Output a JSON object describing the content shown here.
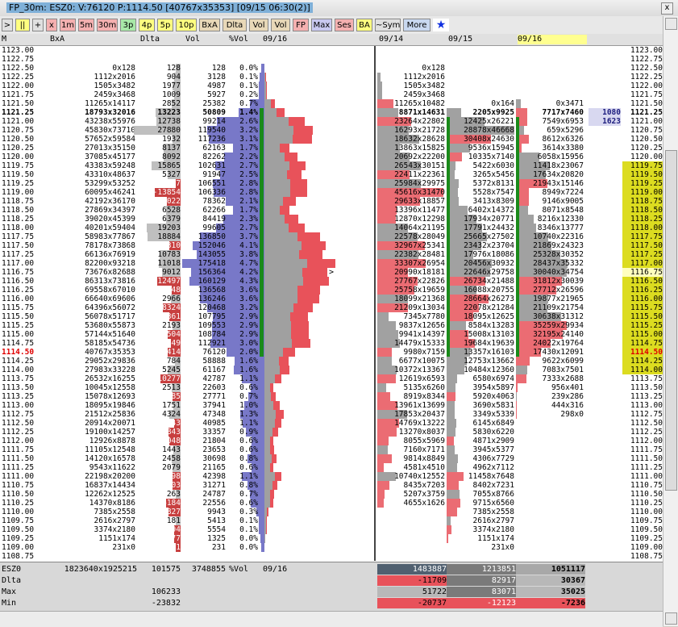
{
  "title": "FP_30m: ESZ0: V:76120 P:1114.50 [40767x35353] [09/15 06:30(2)]",
  "close_label": "x",
  "toolbar": [
    {
      "label": ">",
      "bg": "#e0e0e0",
      "w": 14
    },
    {
      "label": "||",
      "bg": "#ffff80",
      "w": 18
    },
    {
      "label": "+",
      "bg": "#e0e0e0",
      "w": 14
    },
    {
      "label": "x",
      "bg": "#f4b0b0",
      "w": 14
    },
    {
      "label": "1m",
      "bg": "#f4b0b0",
      "w": 20
    },
    {
      "label": "5m",
      "bg": "#f4b0b0",
      "w": 20
    },
    {
      "label": "30m",
      "bg": "#f4b0b0",
      "w": 26
    },
    {
      "label": "3p",
      "bg": "#a8e8a8",
      "w": 20
    },
    {
      "label": "4p",
      "bg": "#ffff80",
      "w": 20
    },
    {
      "label": "5p",
      "bg": "#ffff80",
      "w": 20
    },
    {
      "label": "10p",
      "bg": "#ffff80",
      "w": 26
    },
    {
      "label": "BxA",
      "bg": "#e8d8b8",
      "w": 26
    },
    {
      "label": "Dlta",
      "bg": "#e8d8b8",
      "w": 30
    },
    {
      "label": "Vol",
      "bg": "#e8d8b8",
      "w": 24
    },
    {
      "label": "Vol",
      "bg": "#e8d8b8",
      "w": 24
    },
    {
      "label": "FP",
      "bg": "#f4b0b0",
      "w": 20
    },
    {
      "label": "Max",
      "bg": "#c8c8f0",
      "w": 26
    },
    {
      "label": "Ses",
      "bg": "#f4b0b0",
      "w": 24
    },
    {
      "label": "BA",
      "bg": "#ffff80",
      "w": 20
    },
    {
      "label": "~Sym",
      "bg": "#e0e0e0",
      "w": 32
    },
    {
      "label": "More",
      "bg": "#c8d8f0",
      "w": 34
    },
    {
      "label": "★",
      "bg": "#ffffff",
      "w": 20
    }
  ],
  "header": {
    "m": "M",
    "bxa": "BxA",
    "dlta": "Dlta",
    "vol": "Vol",
    "pvol": "%Vol",
    "d1": "09/16",
    "d2": "09/14",
    "d3": "09/15",
    "d4": "09/16"
  },
  "rows": [
    {
      "p": "1123.00",
      "bxa": "",
      "d": "",
      "v": "",
      "pv": "",
      "c2": "",
      "c3": "",
      "c4": ""
    },
    {
      "p": "1122.75",
      "bxa": "",
      "d": "",
      "v": "",
      "pv": "",
      "c2": "",
      "c3": "",
      "c4": ""
    },
    {
      "p": "1122.50",
      "bxa": "0x128",
      "d": "128",
      "v": "128",
      "pv": "0.0%",
      "c2": "0x128",
      "c3": "",
      "c4": ""
    },
    {
      "p": "1122.25",
      "bxa": "1112x2016",
      "d": "904",
      "v": "3128",
      "pv": "0.1%",
      "c2": "1112x2016",
      "c3": "",
      "c4": ""
    },
    {
      "p": "1122.00",
      "bxa": "1505x3482",
      "d": "1977",
      "v": "4987",
      "pv": "0.1%",
      "c2": "1505x3482",
      "c3": "",
      "c4": ""
    },
    {
      "p": "1121.75",
      "bxa": "2459x3468",
      "d": "1009",
      "v": "5927",
      "pv": "0.2%",
      "c2": "2459x3468",
      "c3": "",
      "c4": ""
    },
    {
      "p": "1121.50",
      "bxa": "11265x14117",
      "d": "2852",
      "v": "25382",
      "pv": "0.7%",
      "c2": "11265x10482",
      "c3": "0x164",
      "c4": "0x3471"
    },
    {
      "p": "1121.25",
      "bxa": "18793x32016",
      "d": "13223",
      "v": "50809",
      "pv": "1.4%",
      "c2": "8871x14631",
      "c3": "2205x9925",
      "c4": "7717x7460",
      "bold": true
    },
    {
      "p": "1121.00",
      "bxa": "43238x55976",
      "d": "12738",
      "v": "99214",
      "pv": "2.6%",
      "c2": "23264x22802",
      "c3": "12425x26221",
      "c4": "7549x6953"
    },
    {
      "p": "1120.75",
      "bxa": "45830x73710",
      "d": "27880",
      "v": "119540",
      "pv": "3.2%",
      "c2": "16293x21728",
      "c3": "28878x46668",
      "c4": "659x5296"
    },
    {
      "p": "1120.50",
      "bxa": "57652x59584",
      "d": "1932",
      "v": "117236",
      "pv": "3.1%",
      "c2": "18632x28628",
      "c3": "30408x24630",
      "c4": "8612x6326"
    },
    {
      "p": "1120.25",
      "bxa": "27013x35150",
      "d": "8137",
      "v": "62163",
      "pv": "1.7%",
      "c2": "13863x15825",
      "c3": "9536x15945",
      "c4": "3614x3380"
    },
    {
      "p": "1120.00",
      "bxa": "37085x45177",
      "d": "8092",
      "v": "82262",
      "pv": "2.2%",
      "c2": "20692x22200",
      "c3": "10335x7140",
      "c4": "6058x15956"
    },
    {
      "p": "1119.75",
      "bxa": "43383x59248",
      "d": "15865",
      "v": "102631",
      "pv": "2.7%",
      "c2": "26543x30151",
      "c3": "5422x6030",
      "c4": "11418x23067"
    },
    {
      "p": "1119.50",
      "bxa": "43310x48637",
      "d": "5327",
      "v": "91947",
      "pv": "2.5%",
      "c2": "22411x22361",
      "c3": "3265x5456",
      "c4": "17634x20820"
    },
    {
      "p": "1119.25",
      "bxa": "53299x53252",
      "d": "-47",
      "v": "106551",
      "pv": "2.8%",
      "c2": "25984x29975",
      "c3": "5372x8131",
      "c4": "21943x15146"
    },
    {
      "p": "1119.00",
      "bxa": "60095x46241",
      "d": "-13854",
      "v": "106336",
      "pv": "2.8%",
      "c2": "45616x31470",
      "c3": "5528x7547",
      "c4": "8949x7224"
    },
    {
      "p": "1118.75",
      "bxa": "42192x36170",
      "d": "-6022",
      "v": "78362",
      "pv": "2.1%",
      "c2": "29633x18857",
      "c3": "3413x8309",
      "c4": "9146x9005"
    },
    {
      "p": "1118.50",
      "bxa": "27869x34397",
      "d": "6528",
      "v": "62266",
      "pv": "1.7%",
      "c2": "13396x11477",
      "c3": "6402x14372",
      "c4": "8071x8548"
    },
    {
      "p": "1118.25",
      "bxa": "39020x45399",
      "d": "6379",
      "v": "84419",
      "pv": "2.3%",
      "c2": "12870x12298",
      "c3": "17934x20771",
      "c4": "8216x12330"
    },
    {
      "p": "1118.00",
      "bxa": "40201x59404",
      "d": "19203",
      "v": "99605",
      "pv": "2.7%",
      "c2": "14064x21195",
      "c3": "17791x24432",
      "c4": "8346x13777"
    },
    {
      "p": "1117.75",
      "bxa": "58983x77867",
      "d": "18884",
      "v": "136850",
      "pv": "3.7%",
      "c2": "22578x28049",
      "c3": "25665x27502",
      "c4": "10740x22316"
    },
    {
      "p": "1117.50",
      "bxa": "78178x73868",
      "d": "-4310",
      "v": "152046",
      "pv": "4.1%",
      "c2": "32967x25341",
      "c3": "23432x23704",
      "c4": "21869x24323"
    },
    {
      "p": "1117.25",
      "bxa": "66136x76919",
      "d": "10783",
      "v": "143055",
      "pv": "3.8%",
      "c2": "22382x28481",
      "c3": "17976x18086",
      "c4": "25328x30352"
    },
    {
      "p": "1117.00",
      "bxa": "82200x93218",
      "d": "11018",
      "v": "175418",
      "pv": "4.7%",
      "c2": "33307x26954",
      "c3": "20456x30932",
      "c4": "28437x35332"
    },
    {
      "p": "1116.75",
      "bxa": "73676x82688",
      "d": "9012",
      "v": "156364",
      "pv": "4.2%",
      "c2": "20990x18181",
      "c3": "22646x29758",
      "c4": "30040x34754"
    },
    {
      "p": "1116.50",
      "bxa": "86313x73816",
      "d": "-12497",
      "v": "160129",
      "pv": "4.3%",
      "c2": "27767x22826",
      "c3": "26734x21488",
      "c4": "31812x30039"
    },
    {
      "p": "1116.25",
      "bxa": "69558x67010",
      "d": "-2548",
      "v": "136568",
      "pv": "3.6%",
      "c2": "25758x19659",
      "c3": "16088x20755",
      "c4": "27712x26596"
    },
    {
      "p": "1116.00",
      "bxa": "66640x69606",
      "d": "2966",
      "v": "136246",
      "pv": "3.6%",
      "c2": "18099x21368",
      "c3": "28664x26273",
      "c4": "19877x21965"
    },
    {
      "p": "1115.75",
      "bxa": "64396x56072",
      "d": "-8324",
      "v": "120468",
      "pv": "3.2%",
      "c2": "21209x13034",
      "c3": "22078x21284",
      "c4": "21109x21754"
    },
    {
      "p": "1115.50",
      "bxa": "56078x51717",
      "d": "-4361",
      "v": "107795",
      "pv": "2.9%",
      "c2": "7345x7780",
      "c3": "18095x12625",
      "c4": "30638x31312"
    },
    {
      "p": "1115.25",
      "bxa": "53680x55873",
      "d": "2193",
      "v": "109553",
      "pv": "2.9%",
      "c2": "9837x12656",
      "c3": "8584x13283",
      "c4": "35259x29934"
    },
    {
      "p": "1115.00",
      "bxa": "57144x51640",
      "d": "-5504",
      "v": "108784",
      "pv": "2.9%",
      "c2": "9941x14397",
      "c3": "15008x13103",
      "c4": "32195x24140"
    },
    {
      "p": "1114.75",
      "bxa": "58185x54736",
      "d": "-3449",
      "v": "112921",
      "pv": "3.0%",
      "c2": "14479x15333",
      "c3": "19684x19639",
      "c4": "24022x19764"
    },
    {
      "p": "1114.50",
      "bxa": "40767x35353",
      "d": "-5414",
      "v": "76120",
      "pv": "2.0%",
      "c2": "9980x7159",
      "c3": "13357x16103",
      "c4": "17430x12091",
      "cur": true
    },
    {
      "p": "1114.25",
      "bxa": "29052x29836",
      "d": "784",
      "v": "58888",
      "pv": "1.6%",
      "c2": "6677x10075",
      "c3": "12753x13662",
      "c4": "9622x6099"
    },
    {
      "p": "1114.00",
      "bxa": "27983x33228",
      "d": "5245",
      "v": "61167",
      "pv": "1.6%",
      "c2": "10372x13367",
      "c3": "10484x12360",
      "c4": "7083x7501"
    },
    {
      "p": "1113.75",
      "bxa": "26532x16255",
      "d": "-10277",
      "v": "42787",
      "pv": "1.1%",
      "c2": "12619x6593",
      "c3": "6580x6974",
      "c4": "7333x2688"
    },
    {
      "p": "1113.50",
      "bxa": "10045x12558",
      "d": "2513",
      "v": "22603",
      "pv": "0.6%",
      "c2": "5135x6260",
      "c3": "3954x5897",
      "c4": "956x401"
    },
    {
      "p": "1113.25",
      "bxa": "15078x12693",
      "d": "-2385",
      "v": "27771",
      "pv": "0.7%",
      "c2": "8919x8344",
      "c3": "5920x4063",
      "c4": "239x286"
    },
    {
      "p": "1113.00",
      "bxa": "18095x19846",
      "d": "1751",
      "v": "37941",
      "pv": "1.0%",
      "c2": "13961x13699",
      "c3": "3690x5831",
      "c4": "444x316"
    },
    {
      "p": "1112.75",
      "bxa": "21512x25836",
      "d": "4324",
      "v": "47348",
      "pv": "1.3%",
      "c2": "17853x20437",
      "c3": "3349x5339",
      "c4": "298x0"
    },
    {
      "p": "1112.50",
      "bxa": "20914x20071",
      "d": "-843",
      "v": "40985",
      "pv": "1.1%",
      "c2": "14769x13222",
      "c3": "6145x6849",
      "c4": ""
    },
    {
      "p": "1112.25",
      "bxa": "19100x14257",
      "d": "-4843",
      "v": "33357",
      "pv": "0.9%",
      "c2": "13270x8037",
      "c3": "5830x6220",
      "c4": ""
    },
    {
      "p": "1112.00",
      "bxa": "12926x8878",
      "d": "-4048",
      "v": "21804",
      "pv": "0.6%",
      "c2": "8055x5969",
      "c3": "4871x2909",
      "c4": ""
    },
    {
      "p": "1111.75",
      "bxa": "11105x12548",
      "d": "1443",
      "v": "23653",
      "pv": "0.6%",
      "c2": "7160x7171",
      "c3": "3945x5377",
      "c4": ""
    },
    {
      "p": "1111.50",
      "bxa": "14120x16578",
      "d": "2458",
      "v": "30698",
      "pv": "0.8%",
      "c2": "9814x8849",
      "c3": "4306x7729",
      "c4": ""
    },
    {
      "p": "1111.25",
      "bxa": "9543x11622",
      "d": "2079",
      "v": "21165",
      "pv": "0.6%",
      "c2": "4581x4510",
      "c3": "4962x7112",
      "c4": ""
    },
    {
      "p": "1111.00",
      "bxa": "22198x20200",
      "d": "-1998",
      "v": "42398",
      "pv": "1.1%",
      "c2": "10740x12552",
      "c3": "11458x7648",
      "c4": ""
    },
    {
      "p": "1110.75",
      "bxa": "16837x14434",
      "d": "-2403",
      "v": "31271",
      "pv": "0.8%",
      "c2": "8435x7203",
      "c3": "8402x7231",
      "c4": ""
    },
    {
      "p": "1110.50",
      "bxa": "12262x12525",
      "d": "263",
      "v": "24787",
      "pv": "0.7%",
      "c2": "5207x3759",
      "c3": "7055x8766",
      "c4": ""
    },
    {
      "p": "1110.25",
      "bxa": "14370x8186",
      "d": "-6184",
      "v": "22556",
      "pv": "0.6%",
      "c2": "4655x1626",
      "c3": "9715x6560",
      "c4": ""
    },
    {
      "p": "1110.00",
      "bxa": "7385x2558",
      "d": "-4827",
      "v": "9943",
      "pv": "0.3%",
      "c2": "",
      "c3": "7385x2558",
      "c4": ""
    },
    {
      "p": "1109.75",
      "bxa": "2616x2797",
      "d": "181",
      "v": "5413",
      "pv": "0.1%",
      "c2": "",
      "c3": "2616x2797",
      "c4": ""
    },
    {
      "p": "1109.50",
      "bxa": "3374x2180",
      "d": "-1194",
      "v": "5554",
      "pv": "0.1%",
      "c2": "",
      "c3": "3374x2180",
      "c4": ""
    },
    {
      "p": "1109.25",
      "bxa": "1151x174",
      "d": "-977",
      "v": "1325",
      "pv": "0.0%",
      "c2": "",
      "c3": "1151x174",
      "c4": ""
    },
    {
      "p": "1109.00",
      "bxa": "231x0",
      "d": "-231",
      "v": "231",
      "pv": "0.0%",
      "c2": "",
      "c3": "231x0",
      "c4": ""
    },
    {
      "p": "1108.75",
      "bxa": "",
      "d": "",
      "v": "",
      "pv": "",
      "c2": "",
      "c3": "",
      "c4": ""
    }
  ],
  "side_labels": [
    {
      "text": "1080",
      "row": 7
    },
    {
      "text": "1623",
      "row": 8
    }
  ],
  "footer": {
    "rows": [
      {
        "label": "ESZ0",
        "bxa": "1823640x1925215",
        "d": "101575",
        "v": "3748855",
        "pv": "%Vol",
        "d1": "09/16",
        "c2": "1483887",
        "c3": "1213851",
        "c4": "1051117"
      },
      {
        "label": "Dlta",
        "bxa": "",
        "d": "",
        "v": "",
        "pv": "",
        "d1": "",
        "c2": "-11709",
        "c3": "82917",
        "c4": "30367"
      },
      {
        "label": "Max",
        "bxa": "",
        "d": "106233",
        "v": "",
        "pv": "",
        "d1": "",
        "c2": "51722",
        "c3": "83071",
        "c4": "35025"
      },
      {
        "label": "Min",
        "bxa": "",
        "d": "-23832",
        "v": "",
        "pv": "",
        "d1": "",
        "c2": "-20737",
        "c3": "-12123",
        "c4": "-7236"
      }
    ]
  },
  "colors": {
    "red": "#e8525a",
    "green": "#1a8a1a",
    "blue": "#8080cc",
    "yellow": "#dcdc20"
  }
}
